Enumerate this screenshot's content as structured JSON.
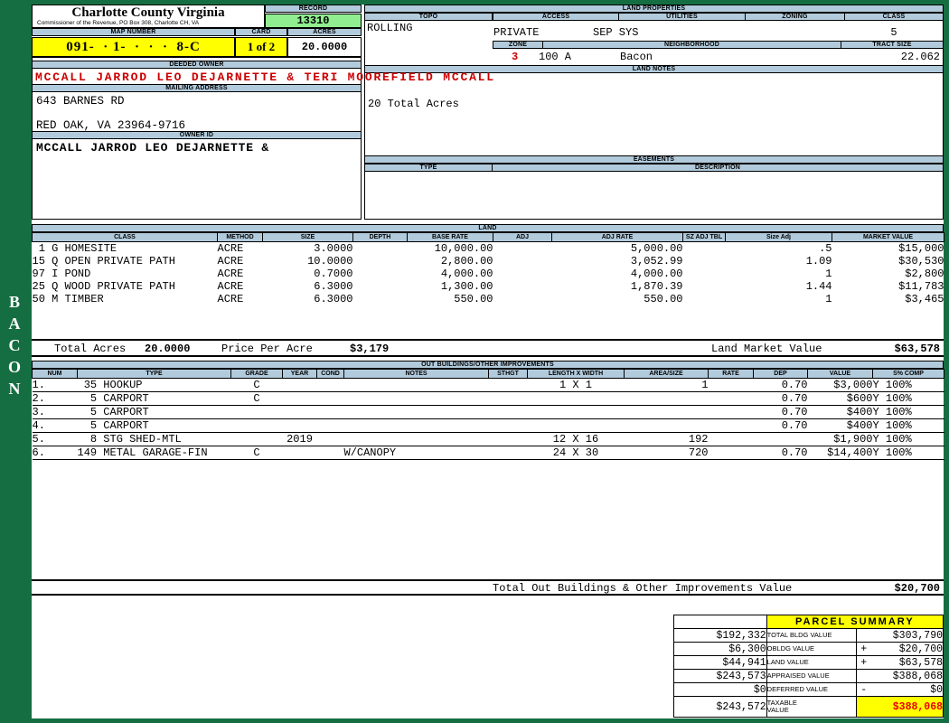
{
  "colors": {
    "frame_green": "#156e42",
    "section_blue": "#b2cbdc",
    "record_green": "#90ee90",
    "highlight_yellow": "#ffff00",
    "alert_red": "#cc0000"
  },
  "sidebar": {
    "vertical_label": "BACON"
  },
  "header": {
    "county_name": "Charlotte County Virginia",
    "county_subtitle": "Commissioner of the Revenue, PO Box 308, Charlotte CH, VA",
    "record_label": "RECORD",
    "record_value": "13310",
    "map_number_label": "MAP NUMBER",
    "map_number_value": "091-  · 1-  ·  ·  ·  8-C",
    "card_label": "CARD",
    "card_value": "1 of 2",
    "acres_label": "ACRES",
    "acres_value": "20.0000"
  },
  "owner": {
    "deeded_owner_label": "DEEDED OWNER",
    "deeded_owner_value": "MCCALL JARROD LEO DEJARNETTE & TERI MOOREFIELD MCCALL",
    "mailing_address_label": "MAILING ADDRESS",
    "address_line1": "643 BARNES RD",
    "address_line2": "RED OAK, VA 23964-9716",
    "owner_id_label": "OWNER ID",
    "owner_id_value": "MCCALL JARROD LEO DEJARNETTE &"
  },
  "land_properties": {
    "section_label": "LAND PROPERTIES",
    "topo_label": "TOPO",
    "topo_value": "ROLLING",
    "access_label": "ACCESS",
    "access_value": "PRIVATE",
    "utilities_label": "UTILITIES",
    "utilities_value": "SEP SYS",
    "zoning_label": "ZONING",
    "zoning_value": "",
    "class_label": "CLASS",
    "class_value": "5",
    "zone_label": "ZONE",
    "zone_value": "3",
    "zone_area": "100 A",
    "neighborhood_label": "NEIGHBORHOOD",
    "neighborhood_value": "Bacon",
    "tract_size_label": "TRACT SIZE",
    "tract_size_value": "22.062"
  },
  "land_notes": {
    "section_label": "LAND NOTES",
    "note": "20 Total Acres"
  },
  "easements": {
    "section_label": "EASEMENTS",
    "type_label": "TYPE",
    "description_label": "DESCRIPTION"
  },
  "land": {
    "section_label": "LAND",
    "columns": [
      "CLASS",
      "METHOD",
      "SIZE",
      "DEPTH",
      "BASE RATE",
      "ADJ",
      "ADJ RATE",
      "SZ ADJ TBL",
      "Size Adj",
      "MARKET VALUE"
    ],
    "rows": [
      [
        " 1 G HOMESITE",
        "ACRE",
        "3.0000",
        "",
        "10,000.00",
        "",
        "5,000.00",
        "",
        ".5",
        "$15,000"
      ],
      [
        "15 Q OPEN PRIVATE PATH",
        "ACRE",
        "10.0000",
        "",
        "2,800.00",
        "",
        "3,052.99",
        "",
        "1.09",
        "$30,530"
      ],
      [
        "97 I POND",
        "ACRE",
        "0.7000",
        "",
        "4,000.00",
        "",
        "4,000.00",
        "",
        "1",
        "$2,800"
      ],
      [
        "25 Q WOOD PRIVATE PATH",
        "ACRE",
        "6.3000",
        "",
        "1,300.00",
        "",
        "1,870.39",
        "",
        "1.44",
        "$11,783"
      ],
      [
        "50 M TIMBER",
        "ACRE",
        "6.3000",
        "",
        "550.00",
        "",
        "550.00",
        "",
        "1",
        "$3,465"
      ]
    ],
    "total_acres_label": "Total Acres",
    "total_acres_value": "20.0000",
    "price_per_acre_label": "Price Per Acre",
    "price_per_acre_value": "$3,179",
    "market_value_label": "Land Market Value",
    "market_value_value": "$63,578"
  },
  "out_buildings": {
    "section_label": "OUT BUILDINGS/OTHER IMPROVEMENTS",
    "columns": [
      "NUM",
      "TYPE",
      "GRADE",
      "YEAR",
      "COND",
      "NOTES",
      "STHGT",
      "LENGTH X WIDTH",
      "AREA/SIZE",
      "RATE",
      "DEP",
      "VALUE",
      "S% COMP"
    ],
    "rows": [
      [
        "1.",
        " 35 HOOKUP",
        "C",
        "",
        "",
        "",
        "",
        "1 X 1",
        "1",
        "",
        "0.70",
        "$3,000",
        "Y 100%"
      ],
      [
        "2.",
        "  5 CARPORT",
        "C",
        "",
        "",
        "",
        "",
        "",
        "",
        "",
        "0.70",
        "$600",
        "Y 100%"
      ],
      [
        "3.",
        "  5 CARPORT",
        "",
        "",
        "",
        "",
        "",
        "",
        "",
        "",
        "0.70",
        "$400",
        "Y 100%"
      ],
      [
        "4.",
        "  5 CARPORT",
        "",
        "",
        "",
        "",
        "",
        "",
        "",
        "",
        "0.70",
        "$400",
        "Y 100%"
      ],
      [
        "5.",
        "  8 STG SHED-MTL",
        "",
        "2019",
        "",
        "",
        "",
        "12 X 16",
        "192",
        "",
        "",
        "$1,900",
        "Y 100%"
      ],
      [
        "6.",
        "149 METAL GARAGE-FIN",
        "C",
        "",
        "",
        "W/CANOPY",
        "",
        "24 X 30",
        "720",
        "",
        "0.70",
        "$14,400",
        "Y 100%"
      ]
    ],
    "total_label": "Total Out Buildings & Other Improvements Value",
    "total_value": "$20,700"
  },
  "parcel_summary": {
    "title": "PARCEL SUMMARY",
    "rows": [
      {
        "prior": "$192,332",
        "label": "TOTAL BLDG VALUE",
        "sign": "",
        "value": "$303,790"
      },
      {
        "prior": "$6,300",
        "label": "OBLDG VALUE",
        "sign": "+",
        "value": "$20,700"
      },
      {
        "prior": "$44,941",
        "label": "LAND VALUE",
        "sign": "+",
        "value": "$63,578"
      },
      {
        "prior": "$243,573",
        "label": "APPRAISED VALUE",
        "sign": "",
        "value": "$388,068"
      },
      {
        "prior": "$0",
        "label": "DEFERRED VALUE",
        "sign": "-",
        "value": "$0"
      }
    ],
    "taxable": {
      "prior": "$243,572",
      "label": "TAXABLE VALUE",
      "value": "$388,068"
    }
  }
}
